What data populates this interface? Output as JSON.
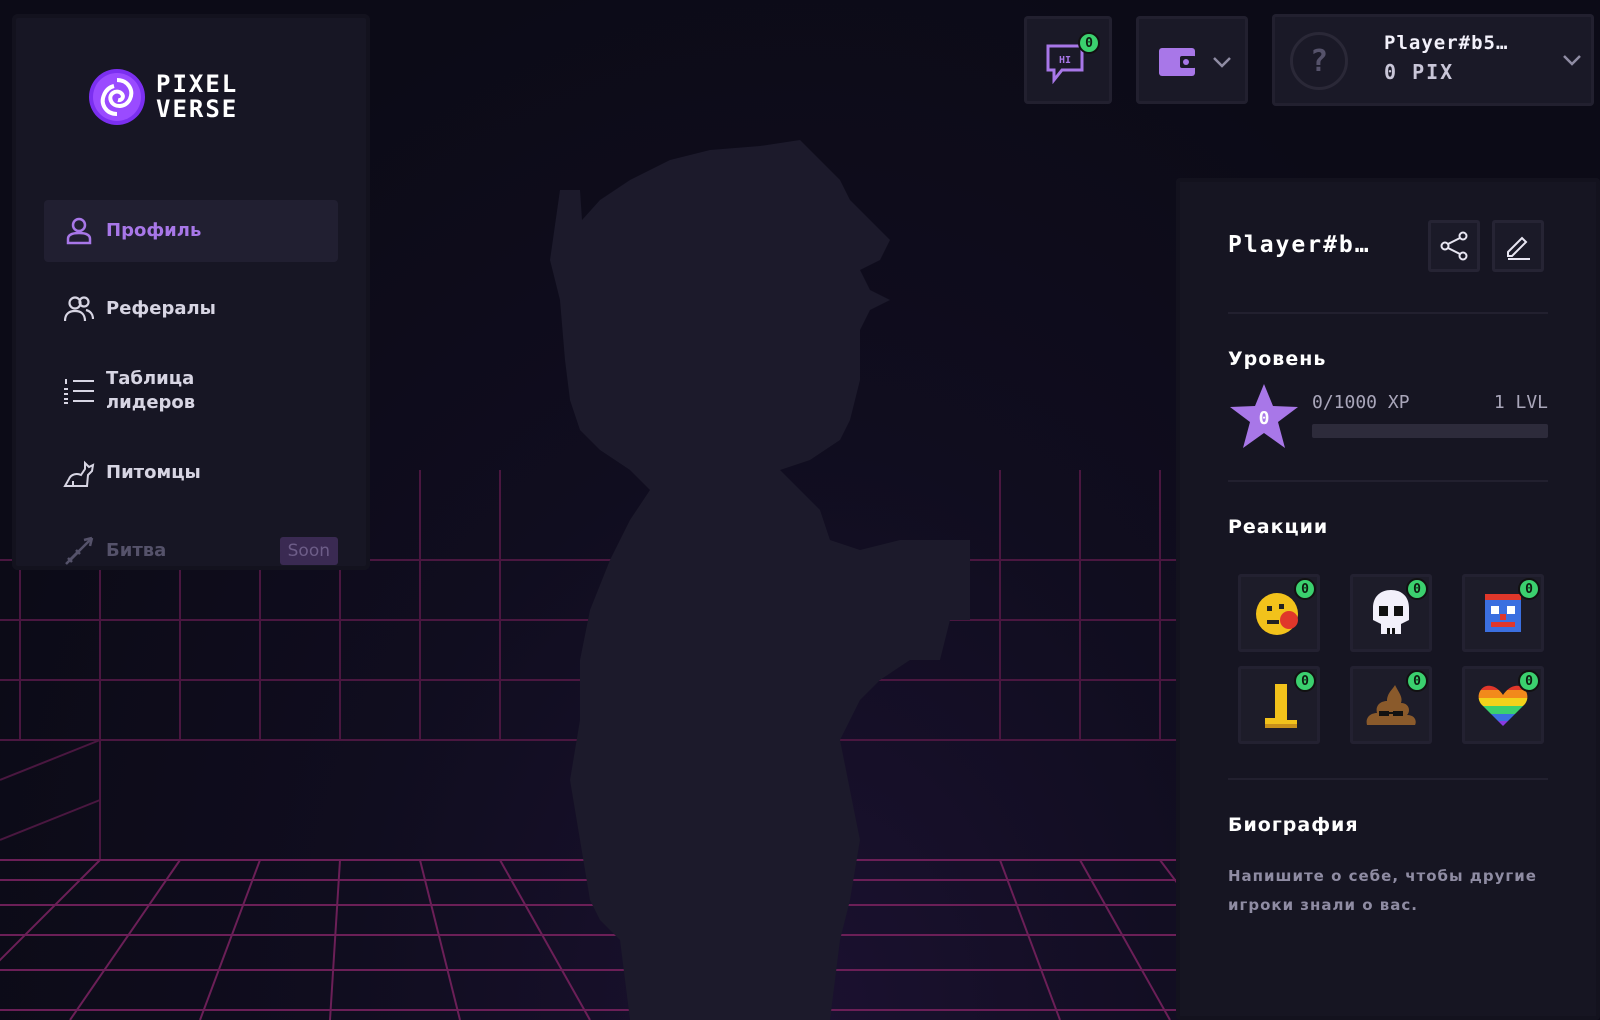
{
  "app": {
    "logo_line1": "PIXEL",
    "logo_line2": "VERSE"
  },
  "sidebar": {
    "items": [
      {
        "label": "Профиль",
        "icon": "user-icon",
        "active": true
      },
      {
        "label": "Рефералы",
        "icon": "users-icon"
      },
      {
        "label": "Таблица лидеров",
        "icon": "list-icon"
      },
      {
        "label": "Питомцы",
        "icon": "pet-icon"
      },
      {
        "label": "Битва",
        "icon": "sword-icon",
        "badge": "Soon",
        "disabled": true
      }
    ]
  },
  "topbar": {
    "chat_badge": "0",
    "chat_icon_text": "HI",
    "account_name": "Player#b5…",
    "account_balance": "0 PIX",
    "avatar_glyph": "?"
  },
  "profile": {
    "name": "Player#b…",
    "level_title": "Уровень",
    "xp_text": "0/1000 XP",
    "lvl_text": "1 LVL",
    "level_number": "0",
    "xp_progress": 0,
    "reactions_title": "Реакции",
    "reactions": [
      {
        "icon": "tomato-face-icon",
        "count": "0"
      },
      {
        "icon": "skull-icon",
        "count": "0"
      },
      {
        "icon": "clown-icon",
        "count": "0"
      },
      {
        "icon": "boot-icon",
        "count": "0"
      },
      {
        "icon": "poop-icon",
        "count": "0"
      },
      {
        "icon": "rainbow-heart-icon",
        "count": "0"
      }
    ],
    "bio_title": "Биография",
    "bio_text": "Напишите о себе, чтобы другие игроки знали о вас."
  },
  "colors": {
    "accent": "#a877e8",
    "badge_green": "#3bd06e",
    "grid_magenta": "#6b1f57"
  }
}
